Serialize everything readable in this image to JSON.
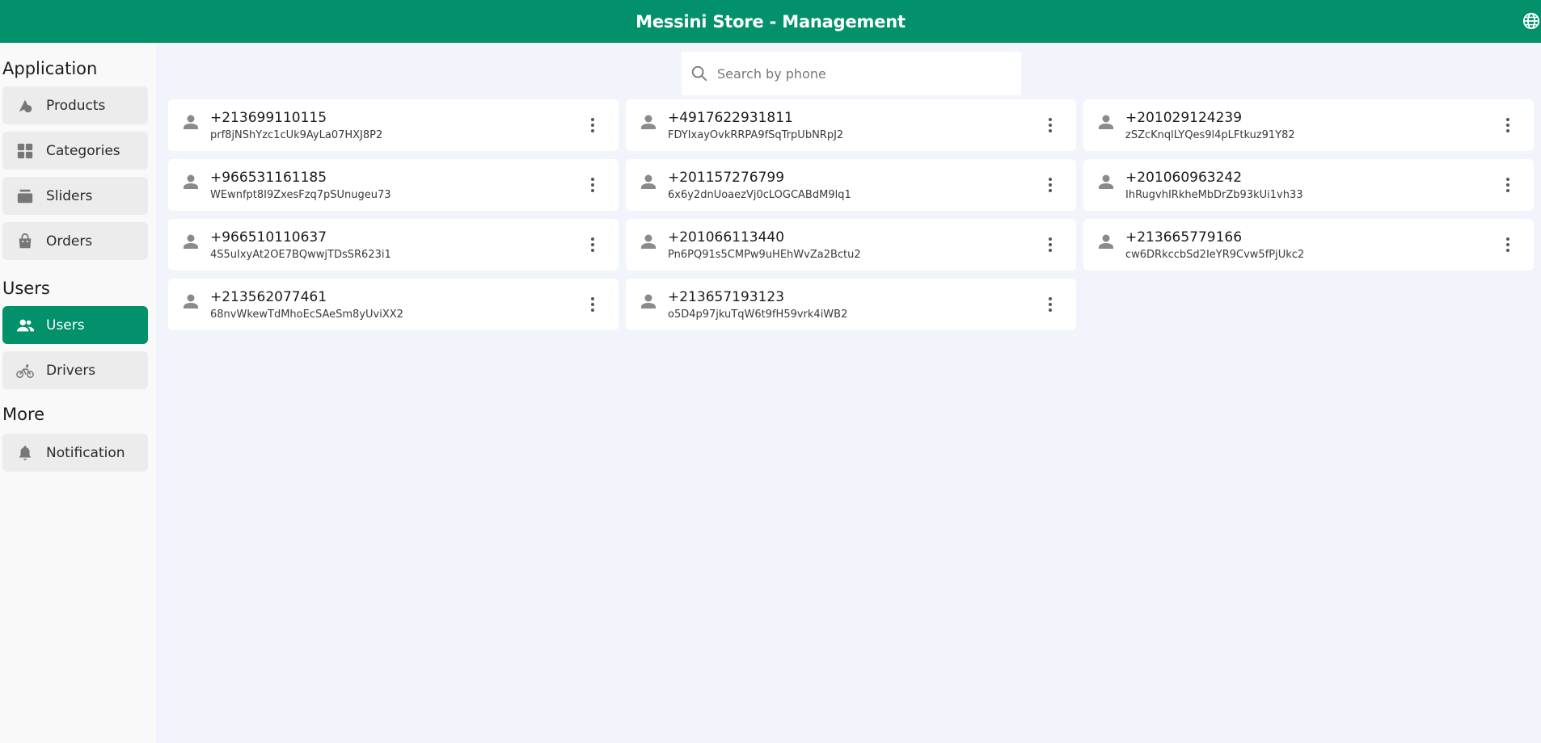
{
  "app": {
    "title": "Messini Store - Management"
  },
  "sidebar": {
    "sections": [
      {
        "title": "Application",
        "items": [
          {
            "label": "Products",
            "icon": "shapes-icon"
          },
          {
            "label": "Categories",
            "icon": "grid-icon"
          },
          {
            "label": "Sliders",
            "icon": "layers-icon"
          },
          {
            "label": "Orders",
            "icon": "bag-icon"
          }
        ]
      },
      {
        "title": "Users",
        "items": [
          {
            "label": "Users",
            "icon": "people-icon",
            "active": true
          },
          {
            "label": "Drivers",
            "icon": "bike-icon"
          }
        ]
      },
      {
        "title": "More",
        "items": [
          {
            "label": "Notification",
            "icon": "bell-icon"
          }
        ]
      }
    ]
  },
  "search": {
    "placeholder": "Search by phone"
  },
  "users": [
    {
      "phone": "+213699110115",
      "uid": "prf8jNShYzc1cUk9AyLa07HXJ8P2"
    },
    {
      "phone": "+4917622931811",
      "uid": "FDYIxayOvkRRPA9fSqTrpUbNRpJ2"
    },
    {
      "phone": "+201029124239",
      "uid": "zSZcKnqlLYQes9l4pLFtkuz91Y82"
    },
    {
      "phone": "+966531161185",
      "uid": "WEwnfpt8I9ZxesFzq7pSUnugeu73"
    },
    {
      "phone": "+201157276799",
      "uid": "6x6y2dnUoaezVj0cLOGCABdM9lq1"
    },
    {
      "phone": "+201060963242",
      "uid": "IhRugvhIRkheMbDrZb93kUi1vh33"
    },
    {
      "phone": "+966510110637",
      "uid": "4S5uIxyAt2OE7BQwwjTDsSR623i1"
    },
    {
      "phone": "+201066113440",
      "uid": "Pn6PQ91s5CMPw9uHEhWvZa2Bctu2"
    },
    {
      "phone": "+213665779166",
      "uid": "cw6DRkccbSd2IeYR9Cvw5fPjUkc2"
    },
    {
      "phone": "+213562077461",
      "uid": "68nvWkewTdMhoEcSAeSm8yUviXX2"
    },
    {
      "phone": "+213657193123",
      "uid": "o5D4p97jkuTqW6t9fH59vrk4iWB2"
    }
  ],
  "colors": {
    "primary": "#02916a",
    "background": "#f1f4fb",
    "sidebar": "#f9f9f9"
  }
}
